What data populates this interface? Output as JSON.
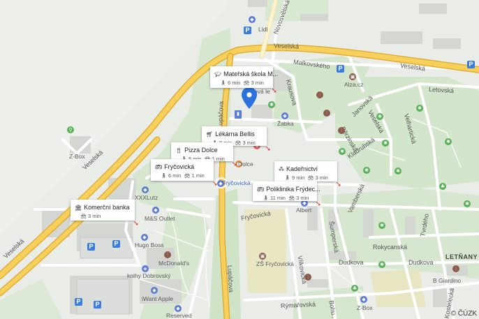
{
  "streets": {
    "veselska_top": "Veselská",
    "veselska_right": "Veselská",
    "veselska_left": "Veselská",
    "veselska_bottom_left": "Veselská",
    "novosvetska": "Novosvětská",
    "malkovskeho": "Malkovského",
    "letovska": "Letovská",
    "krausova": "Krausova",
    "janovska": "Janovská",
    "veselska_north": "Veselská",
    "belinskeho": "Běrzinská",
    "velhartice": "Velhartická",
    "kladrubska": "Kladrubská",
    "lupacova": "Lupáčova",
    "frycovicka_street": "Fryčovická",
    "vambereska": "Vamberská",
    "sumperska": "Šumperská",
    "rokycanska": "Rokycanská",
    "dudkova": "Dudkova",
    "dudkova_right": "Dudkova",
    "vilkovicka": "Vílkovická",
    "frydlantska": "Tvrdého",
    "lupacova_bottom": "Lupáčova",
    "rymarovska": "Rýmařovská",
    "bohumilicka": "Bohu...",
    "kostelecka": "Kostelecká"
  },
  "pois": {
    "lidl": "Lidl",
    "alza": "Alza.cz",
    "zabka": "Žabka",
    "zbox_left": "Z-Box",
    "xxxlutz": "XXXLutz",
    "ms_outlet": "M&S Outlet",
    "hugo_boss": "Hugo Boss",
    "mcdonalds": "McDonald's",
    "knihy": "knihy Dobrovský",
    "iwant": "iWant Apple",
    "reserved": "Reserved",
    "albert": "Albert",
    "zs_frycovicka": "ZŠ Fryčovická",
    "zbox_bottom": "Z-Box",
    "letnany": "LETŇANY",
    "b_giardino": "B Giardino",
    "frycovicka_stop": "Fryčovická",
    "dolce_label": "Dolce",
    "mat_label_partial": "ová le"
  },
  "cards": [
    {
      "title": "Mateřská škola M...",
      "icon": "school-icon",
      "walk": "6 min",
      "car": "3 min"
    },
    {
      "title": "Lékárna Bellis",
      "icon": "cart-icon",
      "walk": "8 min",
      "car": "3 min"
    },
    {
      "title": "Pizza Dolce",
      "icon": "fork-knife-icon",
      "walk": "5 min",
      "car": "1 min"
    },
    {
      "title": "Fryčovická",
      "icon": "bus-icon",
      "walk": "6 min",
      "car": "1 min"
    },
    {
      "title": "Kadeřnictví",
      "icon": "hierarchy-icon",
      "walk": "9 min",
      "car": "3 min"
    },
    {
      "title": "Poliklinika Frýdec...",
      "icon": "bus-icon",
      "walk": "11 min",
      "car": "3 min"
    },
    {
      "title": "Komerční banka",
      "icon": "bank-icon",
      "walk": "",
      "car": "3 min"
    }
  ],
  "copyright": "© ČÚZK",
  "colors": {
    "major_road": "#f5c74a",
    "major_road_edge": "#e2b13a",
    "park": "#cfe3c6",
    "land": "#e8ebe6",
    "pin": "#2b72de",
    "route_arrow": "#d23b3b"
  }
}
